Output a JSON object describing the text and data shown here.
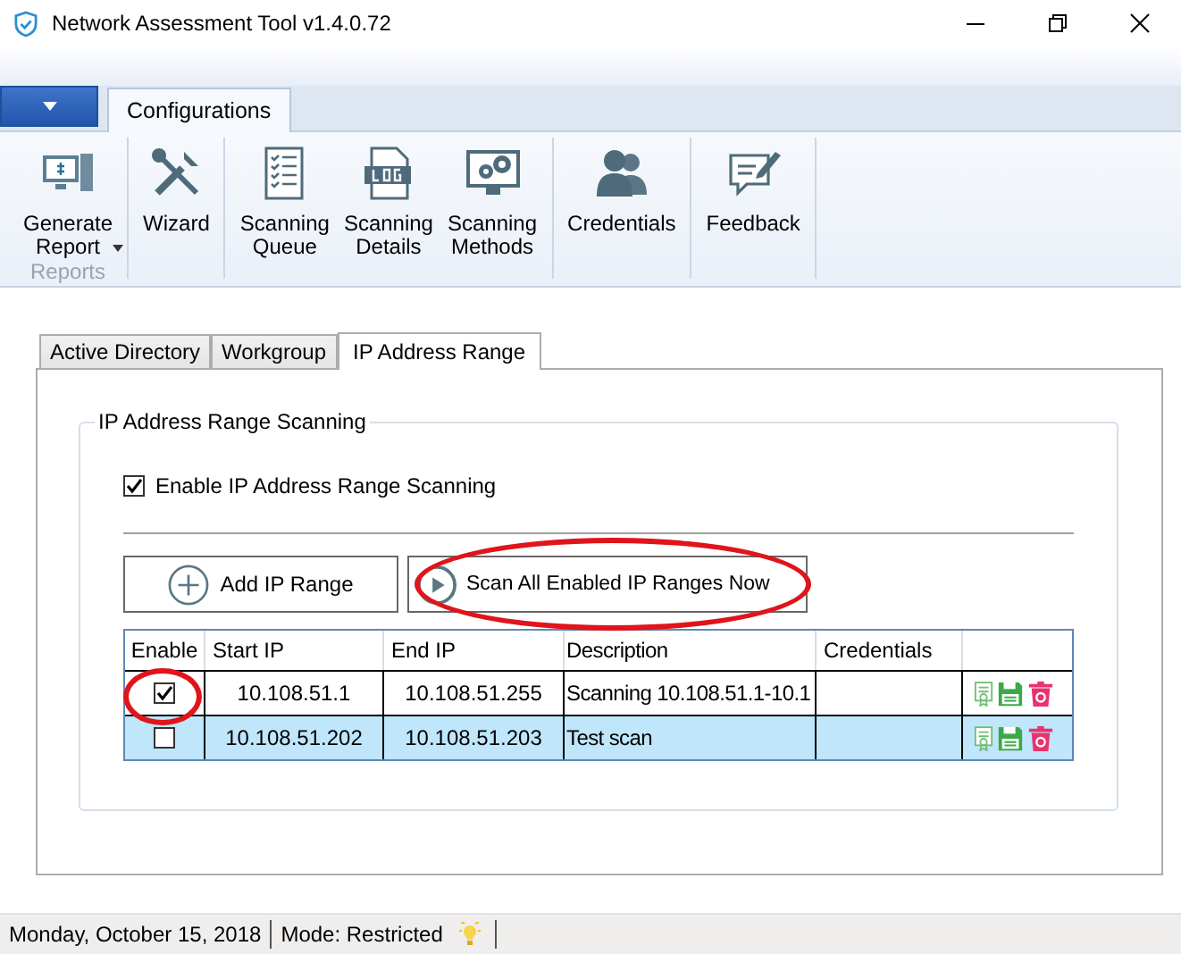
{
  "window": {
    "title": "Network Assessment Tool v1.4.0.72"
  },
  "ribbon": {
    "tabs": [
      {
        "label": "Configurations",
        "selected": true
      }
    ],
    "groups": [
      {
        "label": "Reports",
        "items": [
          {
            "label": "Generate Report",
            "dropdown": true
          }
        ]
      },
      {
        "items": [
          {
            "label": "Wizard",
            "dropdown": false
          }
        ]
      },
      {
        "items": [
          {
            "label": "Scanning Queue",
            "dropdown": false
          },
          {
            "label": "Scanning Details",
            "dropdown": false
          },
          {
            "label": "Scanning Methods",
            "dropdown": false
          }
        ]
      },
      {
        "items": [
          {
            "label": "Credentials",
            "dropdown": false
          }
        ]
      },
      {
        "items": [
          {
            "label": "Feedback",
            "dropdown": false
          }
        ]
      }
    ]
  },
  "tabs": [
    {
      "label": "Active Directory",
      "selected": false
    },
    {
      "label": "Workgroup",
      "selected": false
    },
    {
      "label": "IP Address Range",
      "selected": true
    }
  ],
  "group": {
    "title": "IP Address Range Scanning",
    "enable": {
      "label": "Enable IP Address Range Scanning",
      "checked": true
    }
  },
  "buttons": [
    {
      "kind": "add",
      "label": "Add IP Range"
    },
    {
      "kind": "play",
      "label": "Scan All Enabled IP Ranges Now"
    }
  ],
  "table": {
    "columns": [
      "Enable",
      "Start IP",
      "End IP",
      "Description",
      "Credentials"
    ],
    "rows": [
      {
        "enabled": true,
        "selected": false,
        "start_ip": "10.108.51.1",
        "end_ip": "10.108.51.255",
        "description": "Scanning 10.108.51.1-10.1"
      },
      {
        "enabled": false,
        "selected": true,
        "start_ip": "10.108.51.202",
        "end_ip": "10.108.51.203",
        "description": "Test scan"
      }
    ]
  },
  "annotations": [
    {
      "kind": "ellipse"
    },
    {
      "kind": "ellipse"
    }
  ],
  "status_bar": {
    "date": "Monday, October 15, 2018",
    "mode": "Mode: Restricted"
  }
}
